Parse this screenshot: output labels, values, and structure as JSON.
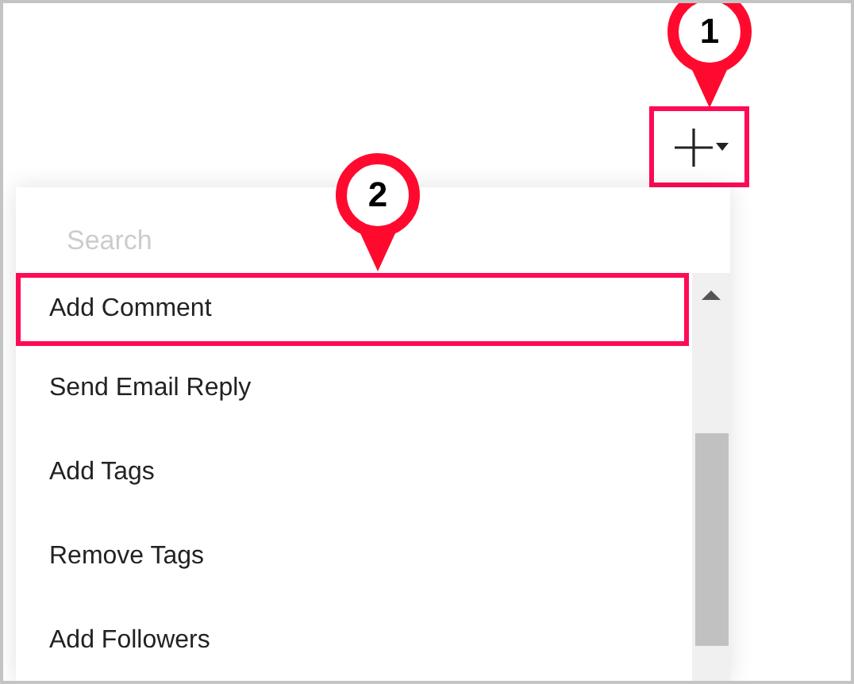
{
  "add_button": {
    "highlighted": true
  },
  "callouts": [
    {
      "number": "1",
      "kind": "button"
    },
    {
      "number": "2",
      "kind": "menu"
    }
  ],
  "menu": {
    "search": {
      "placeholder": "Search"
    },
    "items": [
      {
        "label": "Add Comment",
        "highlighted": true
      },
      {
        "label": "Send Email Reply",
        "highlighted": false
      },
      {
        "label": "Add Tags",
        "highlighted": false
      },
      {
        "label": "Remove Tags",
        "highlighted": false
      },
      {
        "label": "Add Followers",
        "highlighted": false
      }
    ]
  }
}
